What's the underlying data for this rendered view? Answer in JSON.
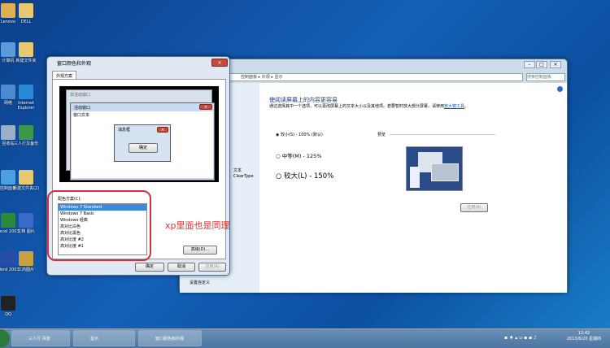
{
  "desktop": {
    "icons": [
      {
        "label": "Lenovo",
        "color": "#e0b050"
      },
      {
        "label": "DELL",
        "color": "#e8c870"
      },
      {
        "label": "计算机",
        "color": "#5a9ad8"
      },
      {
        "label": "新建文件夹",
        "color": "#e8c870"
      },
      {
        "label": "网络",
        "color": "#4a8ad0"
      },
      {
        "label": "Internet Explorer",
        "color": "#2a8ad8"
      },
      {
        "label": "回收站",
        "color": "#9ab0c8"
      },
      {
        "label": "三人行及备份",
        "color": "#3a9a4a"
      },
      {
        "label": "控制面板",
        "color": "#4aa0e0"
      },
      {
        "label": "新建文件夹(2)",
        "color": "#e8c870"
      },
      {
        "label": "Excel 2003",
        "color": "#2a8a3a"
      },
      {
        "label": "文档 图片",
        "color": "#3a6ac8"
      },
      {
        "label": "Word 2003",
        "color": "#2a4aa8"
      },
      {
        "label": "工商图片",
        "color": "#c8a040"
      },
      {
        "label": "QQ",
        "color": "#222222"
      }
    ]
  },
  "appearance_dialog": {
    "title": "窗口颜色和外观",
    "tab": "外观方案",
    "preview": {
      "inactive_title": "非活动窗口",
      "active_title": "活动窗口",
      "window_text": "窗口文本",
      "msgbox_title": "消息框",
      "msgbox_button": "确定"
    },
    "scheme_label": "配色方案(C):",
    "schemes": [
      "Windows 7 Standard",
      "Windows 7 Basic",
      "Windows 经典",
      "高对比白色",
      "高对比黑色",
      "高对比度 #2",
      "高对比度 #1"
    ],
    "selected_scheme": "Windows 7 Standard",
    "advanced_button": "高级(D)...",
    "ok_button": "确定",
    "cancel_button": "取消",
    "apply_button": "应用(A)"
  },
  "annotation": {
    "text": "xp里面也是同理",
    "color": "#e03030"
  },
  "display_window": {
    "breadcrumb": [
      "控制面板",
      "外观",
      "显示"
    ],
    "search_placeholder": "搜索控制面板",
    "heading": "使阅读屏幕上的内容更容易",
    "description": "通过选择其中一个选项，可以更改屏幕上的文本大小以及其他项。若要暂时放大部分屏幕，请使用",
    "link": "放大镜工具",
    "description_end": "。",
    "options": [
      {
        "label": "较小(S) - 100% (默认)",
        "selected": true
      },
      {
        "label": "中等(M) - 125%",
        "selected": false
      },
      {
        "label": "较大(L) - 150%",
        "selected": false
      }
    ],
    "preview_label": "预览",
    "apply_button": "应用(A)",
    "sidebar": [
      "文本",
      "ClearType",
      "设置自定义"
    ]
  },
  "taskbar": {
    "items": [
      "三人行 百度",
      "显示",
      "窗口颜色和外观"
    ],
    "time": "12:42",
    "date": "2013/6/20 星期四"
  }
}
